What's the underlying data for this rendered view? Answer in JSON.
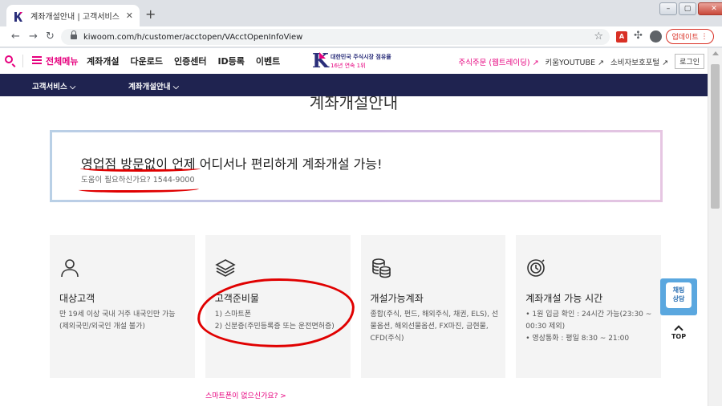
{
  "browser": {
    "tab_title": "계좌개설안내 | 고객서비스 | 키움",
    "tab_close": "✕",
    "new_tab": "+",
    "url": "kiwoom.com/h/customer/acctopen/VAcctOpenInfoView",
    "update_label": "업데이트",
    "menu_dots": "⋮",
    "window_controls": [
      "–",
      "▢",
      "✕"
    ]
  },
  "site": {
    "all_menu": "전체메뉴",
    "gnb": [
      "계좌개설",
      "다운로드",
      "인증센터",
      "ID등록",
      "이벤트"
    ],
    "logo": {
      "k": "K",
      "line1": "대한민국 주식시장 점유율",
      "line2": "16년 연속 1위"
    },
    "right_links": [
      "주식주문 (웹트레이딩) ↗",
      "키움YOUTUBE ↗",
      "소비자보호포털 ↗"
    ],
    "login": "로그인"
  },
  "subnav": [
    "고객서비스 ⌵",
    "계좌개설안내 ⌵"
  ],
  "page": {
    "title": "계좌개설안내",
    "banner_title": "영업점 방문없이 언제 어디서나 편리하게 계좌개설 가능!",
    "banner_sub": "도움이 필요하신가요? 1544-9000"
  },
  "cards": [
    {
      "title": "대상고객",
      "icon": "person-icon",
      "lines": [
        "만 19세 이상 국내 거주 내국인만 가능",
        "(제외국민/외국인 개설 불가)"
      ]
    },
    {
      "title": "고객준비물",
      "icon": "layers-icon",
      "lines": [
        "1) 스마트폰",
        "2) 신분증(주민등록증 또는 운전면허증)"
      ]
    },
    {
      "title": "개설가능계좌",
      "icon": "coins-icon",
      "lines": [
        "종합(주식, 펀드, 해외주식, 채권, ELS), 선",
        "물옵션, 해외선물옵션, FX마진, 금현물,",
        "CFD(주식)"
      ]
    },
    {
      "title": "계좌개설 가능 시간",
      "icon": "clock-icon",
      "lines": [
        "• 1원 입금 확인 : 24시간 가능(23:30 ~",
        "   00:30 제외)",
        "• 영상통화 : 평일 8:30 ~ 21:00"
      ]
    }
  ],
  "smart_link": "스마트폰이 없으신가요? >",
  "chat": {
    "line1": "채팅",
    "line2": "상담"
  },
  "top": "TOP",
  "colors": {
    "brand_pink": "#e6007e",
    "navy": "#1f2350",
    "chat_blue": "#5aa7df"
  }
}
